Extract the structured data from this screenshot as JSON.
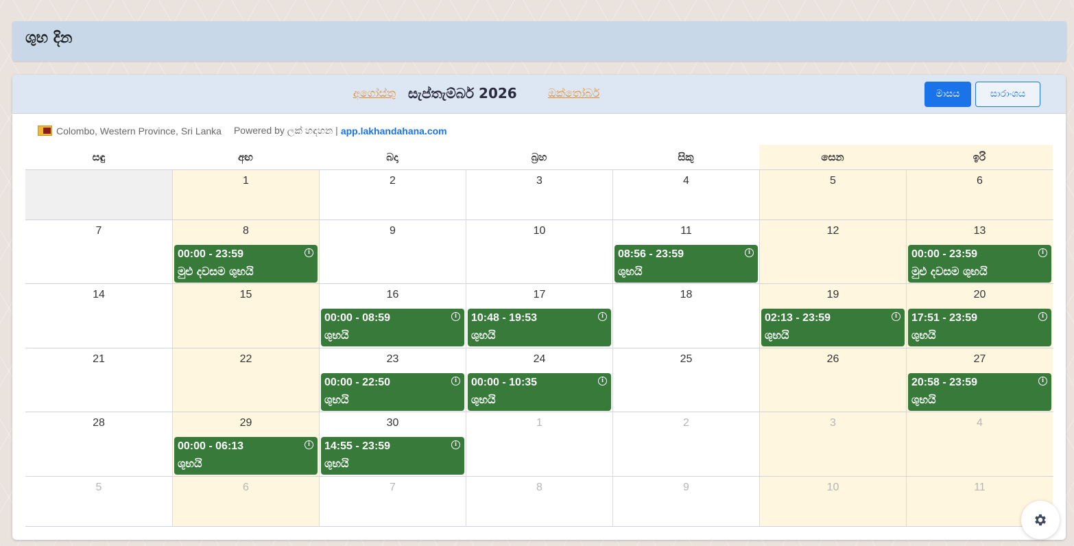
{
  "header": {
    "title": "ශුභ දින"
  },
  "nav": {
    "prev_month": "අගෝස්තු",
    "current": "සැප්තැම්බර් 2026",
    "next_month": "ඔක්තෝබර්"
  },
  "view_buttons": {
    "month": "මාසය",
    "summary": "සාරාංශය"
  },
  "info": {
    "location": "Colombo, Western Province, Sri Lanka",
    "powered_by": "Powered by ලක් හඳහන |",
    "app_link": "app.lakhandahana.com"
  },
  "colors": {
    "event_bg": "#377a3a",
    "weekend_bg": "#fff6e0",
    "accent": "#1a73e8",
    "nav_link": "#e08a2c"
  },
  "icons": {
    "event_info": "info-circle-icon",
    "settings": "gear-icon",
    "flag": "sri-lanka-flag-icon"
  },
  "weekdays": [
    {
      "label": "සඳු",
      "weekend": false
    },
    {
      "label": "අඟ",
      "weekend": false
    },
    {
      "label": "බදා",
      "weekend": false
    },
    {
      "label": "බ්‍රහ",
      "weekend": false
    },
    {
      "label": "සිකු",
      "weekend": false
    },
    {
      "label": "සෙන",
      "weekend": true
    },
    {
      "label": "ඉරි",
      "weekend": true
    }
  ],
  "weeks": [
    {
      "days": [
        {
          "date": "",
          "blank": true
        },
        {
          "date": "1",
          "weekend": true
        },
        {
          "date": "2"
        },
        {
          "date": "3"
        },
        {
          "date": "4"
        },
        {
          "date": "5",
          "weekend": true
        },
        {
          "date": "6",
          "weekend": true
        }
      ]
    },
    {
      "days": [
        {
          "date": "7"
        },
        {
          "date": "8",
          "weekend": true,
          "event": {
            "time": "00:00 - 23:59",
            "label": "මුළු දවසම ශුභයි"
          }
        },
        {
          "date": "9"
        },
        {
          "date": "10"
        },
        {
          "date": "11",
          "event": {
            "time": "08:56 - 23:59",
            "label": "ශුභයි"
          }
        },
        {
          "date": "12",
          "weekend": true
        },
        {
          "date": "13",
          "weekend": true,
          "event": {
            "time": "00:00 - 23:59",
            "label": "මුළු දවසම ශුභයි"
          }
        }
      ]
    },
    {
      "days": [
        {
          "date": "14"
        },
        {
          "date": "15",
          "weekend": true
        },
        {
          "date": "16",
          "event": {
            "time": "00:00 - 08:59",
            "label": "ශුභයි"
          }
        },
        {
          "date": "17",
          "event": {
            "time": "10:48 - 19:53",
            "label": "ශුභයි"
          }
        },
        {
          "date": "18"
        },
        {
          "date": "19",
          "weekend": true,
          "event": {
            "time": "02:13 - 23:59",
            "label": "ශුභයි"
          }
        },
        {
          "date": "20",
          "weekend": true,
          "event": {
            "time": "17:51 - 23:59",
            "label": "ශුභයි"
          }
        }
      ]
    },
    {
      "days": [
        {
          "date": "21"
        },
        {
          "date": "22",
          "weekend": true
        },
        {
          "date": "23",
          "event": {
            "time": "00:00 - 22:50",
            "label": "ශුභයි"
          }
        },
        {
          "date": "24",
          "event": {
            "time": "00:00 - 10:35",
            "label": "ශුභයි"
          }
        },
        {
          "date": "25"
        },
        {
          "date": "26",
          "weekend": true
        },
        {
          "date": "27",
          "weekend": true,
          "event": {
            "time": "20:58 - 23:59",
            "label": "ශුභයි"
          }
        }
      ]
    },
    {
      "days": [
        {
          "date": "28"
        },
        {
          "date": "29",
          "weekend": true,
          "event": {
            "time": "00:00 - 06:13",
            "label": "ශුභයි"
          }
        },
        {
          "date": "30",
          "event": {
            "time": "14:55 - 23:59",
            "label": "ශුභයි"
          }
        },
        {
          "date": "1",
          "other": true
        },
        {
          "date": "2",
          "other": true
        },
        {
          "date": "3",
          "weekend": true,
          "other": true
        },
        {
          "date": "4",
          "weekend": true,
          "other": true
        }
      ]
    },
    {
      "days": [
        {
          "date": "5",
          "other": true
        },
        {
          "date": "6",
          "weekend": true,
          "other": true
        },
        {
          "date": "7",
          "other": true
        },
        {
          "date": "8",
          "other": true
        },
        {
          "date": "9",
          "other": true
        },
        {
          "date": "10",
          "weekend": true,
          "other": true
        },
        {
          "date": "11",
          "weekend": true,
          "other": true
        }
      ]
    }
  ]
}
